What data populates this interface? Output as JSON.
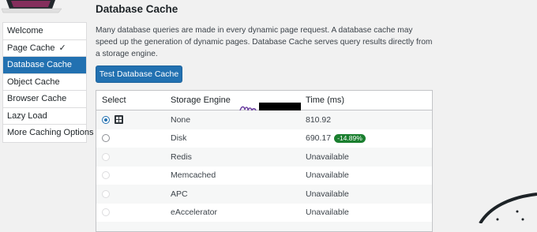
{
  "sidebar": {
    "items": [
      {
        "label": "Welcome"
      },
      {
        "label": "Page Cache",
        "check": "✓"
      },
      {
        "label": "Database Cache"
      },
      {
        "label": "Object Cache"
      },
      {
        "label": "Browser Cache"
      },
      {
        "label": "Lazy Load"
      },
      {
        "label": "More Caching Options"
      }
    ],
    "active_color": "#2271b1"
  },
  "main": {
    "title": "Database Cache",
    "description": "Many database queries are made in every dynamic page request. A database cache may speed up the generation of dynamic pages. Database Cache serves query results directly from a storage engine.",
    "test_button": "Test Database Cache"
  },
  "table": {
    "headers": {
      "select": "Select",
      "engine": "Storage Engine",
      "time": "Time (ms)"
    },
    "rows": [
      {
        "engine": "None",
        "time": "810.92",
        "selected": true
      },
      {
        "engine": "Disk",
        "time": "690.17",
        "badge": "-14.89%"
      },
      {
        "engine": "Redis",
        "time": "Unavailable"
      },
      {
        "engine": "Memcached",
        "time": "Unavailable"
      },
      {
        "engine": "APC",
        "time": "Unavailable"
      },
      {
        "engine": "eAccelerator",
        "time": "Unavailable"
      }
    ],
    "badge_color": "#1a7f2f"
  }
}
